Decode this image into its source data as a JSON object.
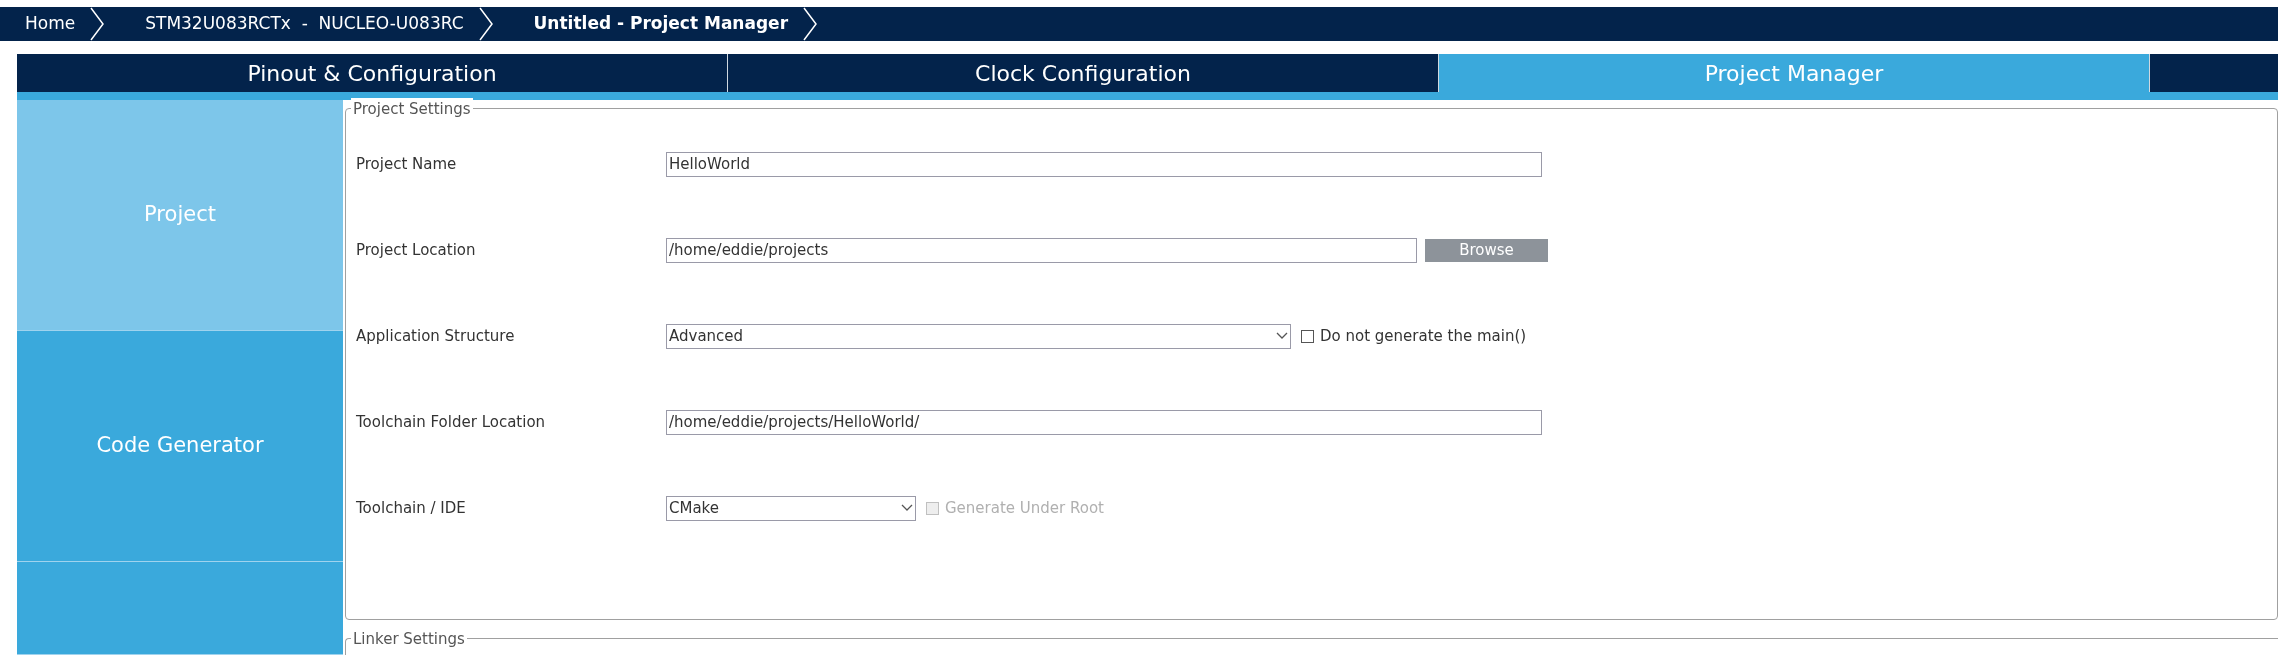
{
  "breadcrumbs": [
    {
      "label": "Home",
      "current": false
    },
    {
      "label": "STM32U083RCTx  -  NUCLEO-U083RC",
      "current": false
    },
    {
      "label": "Untitled - Project Manager",
      "current": true
    }
  ],
  "tabs": [
    {
      "label": "Pinout & Configuration",
      "selected": false
    },
    {
      "label": "Clock Configuration",
      "selected": false
    },
    {
      "label": "Project Manager",
      "selected": true
    }
  ],
  "sidebar": {
    "items": [
      {
        "label": "Project",
        "selected": true
      },
      {
        "label": "Code Generator",
        "selected": false
      },
      {
        "selected": false
      }
    ]
  },
  "project_settings": {
    "title": "Project Settings",
    "rows": [
      {
        "kind": "text",
        "label": "Project Name",
        "value": "HelloWorld"
      },
      {
        "kind": "browse",
        "label": "Project Location",
        "value": "/home/eddie/projects",
        "button": "Browse"
      },
      {
        "kind": "select",
        "label": "Application Structure",
        "value": "Advanced",
        "checkbox": {
          "label": "Do not generate the main()",
          "checked": false,
          "disabled": false
        }
      },
      {
        "kind": "text",
        "label": "Toolchain Folder Location",
        "value": "/home/eddie/projects/HelloWorld/"
      },
      {
        "kind": "select_small",
        "label": "Toolchain / IDE",
        "value": "CMake",
        "checkbox": {
          "label": "Generate Under Root",
          "checked": false,
          "disabled": true
        }
      }
    ]
  },
  "linker_settings": {
    "title": "Linker Settings"
  }
}
